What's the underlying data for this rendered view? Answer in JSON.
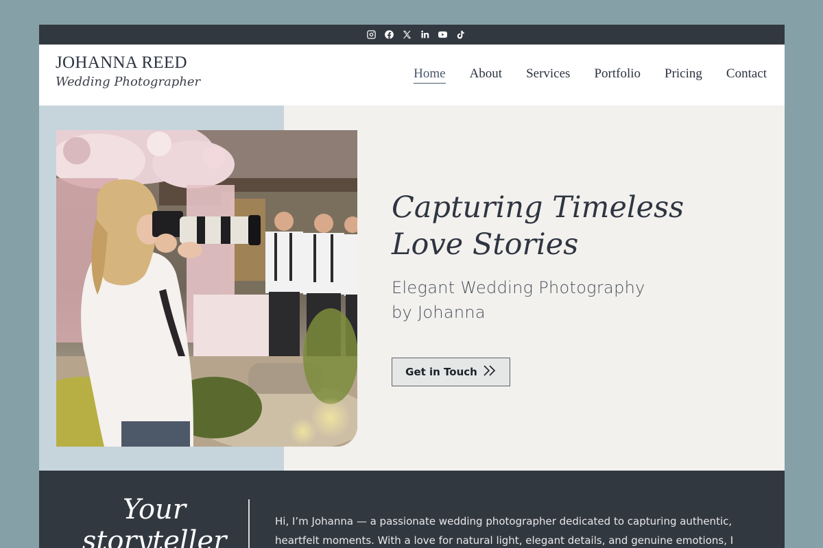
{
  "social": {
    "icons": [
      "instagram-icon",
      "facebook-icon",
      "x-icon",
      "linkedin-icon",
      "youtube-icon",
      "tiktok-icon"
    ]
  },
  "brand": {
    "name": "JOHANNA REED",
    "tagline": "Wedding Photographer"
  },
  "nav": {
    "items": [
      "Home",
      "About",
      "Services",
      "Portfolio",
      "Pricing",
      "Contact"
    ],
    "active": "Home"
  },
  "hero": {
    "title_line1": "Capturing Timeless",
    "title_line2": "Love Stories",
    "subtitle_line1": "Elegant Wedding Photography",
    "subtitle_line2": "by Johanna",
    "cta_label": "Get in Touch"
  },
  "about": {
    "heading_line1": "Your",
    "heading_line2": "storyteller",
    "text": "Hi, I’m Johanna — a passionate wedding photographer dedicated to capturing authentic, heartfelt moments. With a love for natural light, elegant details, and genuine emotions, I strive"
  },
  "colors": {
    "page_bg": "#86a0a7",
    "dark": "#323840",
    "hero_bg": "#f2f1ee",
    "hero_left": "#c6d5db"
  }
}
